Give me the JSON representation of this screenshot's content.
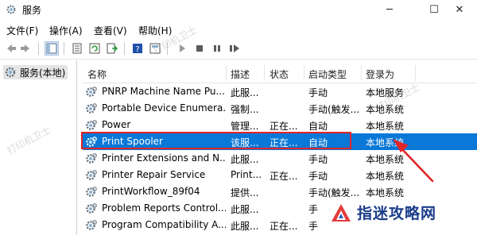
{
  "window": {
    "title": "服务",
    "minimize": "─",
    "maximize": "☐",
    "close": "✕"
  },
  "menu": [
    "文件(F)",
    "操作(A)",
    "查看(V)",
    "帮助(H)"
  ],
  "tree": {
    "root_label": "服务(本地)"
  },
  "columns": [
    "名称",
    "描述",
    "状态",
    "启动类型",
    "登录为"
  ],
  "rows": [
    {
      "name": "PNRP Machine Name Pu...",
      "desc": "此服...",
      "status": "",
      "startup": "手动",
      "logon": "本地服务"
    },
    {
      "name": "Portable Device Enumera...",
      "desc": "强制...",
      "status": "",
      "startup": "手动(触发...",
      "logon": "本地系统"
    },
    {
      "name": "Power",
      "desc": "管理...",
      "status": "正在...",
      "startup": "自动",
      "logon": "本地系统"
    },
    {
      "name": "Print Spooler",
      "desc": "该服...",
      "status": "正在...",
      "startup": "自动",
      "logon": "本地系统",
      "selected": true
    },
    {
      "name": "Printer Extensions and N...",
      "desc": "此服...",
      "status": "",
      "startup": "手动",
      "logon": "本地系统"
    },
    {
      "name": "Printer Repair Service",
      "desc": "Print...",
      "status": "正在...",
      "startup": "手动",
      "logon": "本地系统"
    },
    {
      "name": "PrintWorkflow_89f04",
      "desc": "提供...",
      "status": "",
      "startup": "手动(触发...",
      "logon": "本地系统"
    },
    {
      "name": "Problem Reports Control...",
      "desc": "此服...",
      "status": "",
      "startup": "手",
      "logon": ""
    },
    {
      "name": "Program Compatibility A...",
      "desc": "此服...",
      "status": "正在...",
      "startup": "手",
      "logon": ""
    }
  ],
  "watermarks": [
    "打印机卫士",
    "打印机卫士",
    "打印机卫士"
  ],
  "logo": {
    "text": "指迷攻略网"
  },
  "colors": {
    "selection": "#0a78d7",
    "highlight_box": "#e0252a",
    "arrow": "#e0252a"
  },
  "toolbar_icons": [
    "back-arrow-icon",
    "forward-arrow-icon",
    "show-tree-icon",
    "properties-icon",
    "refresh-icon",
    "export-icon",
    "help-icon",
    "view-icon",
    "start-icon",
    "stop-icon",
    "pause-icon",
    "restart-icon"
  ]
}
